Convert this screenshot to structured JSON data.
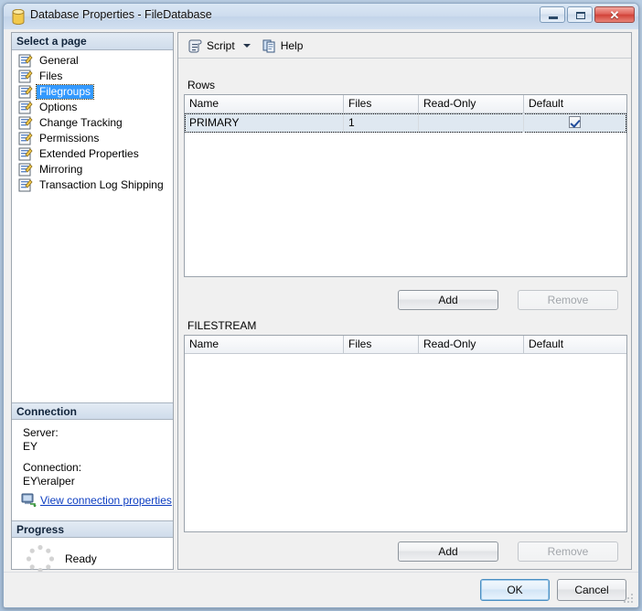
{
  "window": {
    "title": "Database Properties - FileDatabase",
    "icon": "database-cylinder-icon",
    "controls": {
      "minimize": "minimize-icon",
      "maximize": "maximize-icon",
      "close": "✕"
    }
  },
  "sidebar": {
    "header": "Select a page",
    "items": [
      {
        "label": "General",
        "selected": false
      },
      {
        "label": "Files",
        "selected": false
      },
      {
        "label": "Filegroups",
        "selected": true
      },
      {
        "label": "Options",
        "selected": false
      },
      {
        "label": "Change Tracking",
        "selected": false
      },
      {
        "label": "Permissions",
        "selected": false
      },
      {
        "label": "Extended Properties",
        "selected": false
      },
      {
        "label": "Mirroring",
        "selected": false
      },
      {
        "label": "Transaction Log Shipping",
        "selected": false
      }
    ],
    "connection": {
      "header": "Connection",
      "server_label": "Server:",
      "server_value": "EY",
      "connection_label": "Connection:",
      "connection_value": "EY\\eralper",
      "link": "View connection properties"
    },
    "progress": {
      "header": "Progress",
      "status": "Ready"
    }
  },
  "toolbar": {
    "script_label": "Script",
    "script_icon": "script-scroll-icon",
    "dropdown_icon": "chevron-down-icon",
    "help_label": "Help",
    "help_icon": "help-page-icon"
  },
  "main": {
    "rows": {
      "label": "Rows",
      "columns": [
        "Name",
        "Files",
        "Read-Only",
        "Default"
      ],
      "rows": [
        {
          "name": "PRIMARY",
          "files": "1",
          "read_only": "",
          "default": true,
          "selected": true
        }
      ],
      "add_label": "Add",
      "remove_label": "Remove",
      "remove_enabled": false
    },
    "filestream": {
      "label": "FILESTREAM",
      "columns": [
        "Name",
        "Files",
        "Read-Only",
        "Default"
      ],
      "rows": [],
      "add_label": "Add",
      "remove_label": "Remove",
      "remove_enabled": false
    }
  },
  "footer": {
    "ok_label": "OK",
    "cancel_label": "Cancel"
  },
  "colors": {
    "selection_blue": "#3399ff",
    "link_blue": "#0b3cc1",
    "titlebar": "#cddcee",
    "close_red": "#d14238",
    "check_blue": "#1f4b9b"
  }
}
